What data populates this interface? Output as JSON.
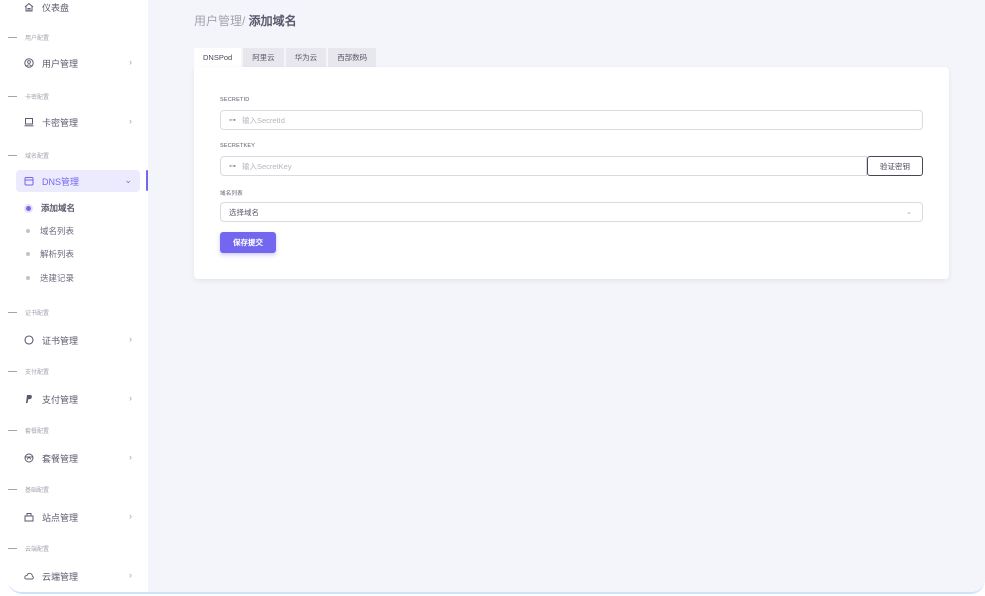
{
  "sidebar": {
    "dashboard": "仪表盘",
    "sections": {
      "user": "用户配置",
      "card": "卡密配置",
      "domain": "域名配置",
      "cert": "证书配置",
      "pay": "支付配置",
      "package": "套餐配置",
      "basic": "基础配置",
      "cloud": "云端配置"
    },
    "items": {
      "user_mgmt": "用户管理",
      "card_mgmt": "卡密管理",
      "dns_mgmt": "DNS管理",
      "cert_mgmt": "证书管理",
      "pay_mgmt": "支付管理",
      "package_mgmt": "套餐管理",
      "site_mgmt": "站点管理",
      "cloud_mgmt": "云端管理"
    },
    "dns_sub": [
      "添加域名",
      "域名列表",
      "解析列表",
      "迭建记录"
    ],
    "arrow": "›",
    "arrow_open": "⌄"
  },
  "breadcrumb": {
    "parent": "用户管理/ ",
    "current": "添加域名"
  },
  "tabs": [
    "DNSPod",
    "阿里云",
    "华为云",
    "西部数码"
  ],
  "form": {
    "secretid_label": "SECRETID",
    "secretid_placeholder": "输入SecretId",
    "secretkey_label": "SECRETKEY",
    "secretkey_placeholder": "输入SecretKey",
    "verify_button": "验证密钥",
    "domain_list_label": "域名列表",
    "domain_select_value": "选择域名",
    "submit_button": "保存提交",
    "key_glyph": "⊶",
    "chevron": "⌄"
  },
  "colors": {
    "accent": "#7367f0",
    "background": "#f4f5fb"
  }
}
